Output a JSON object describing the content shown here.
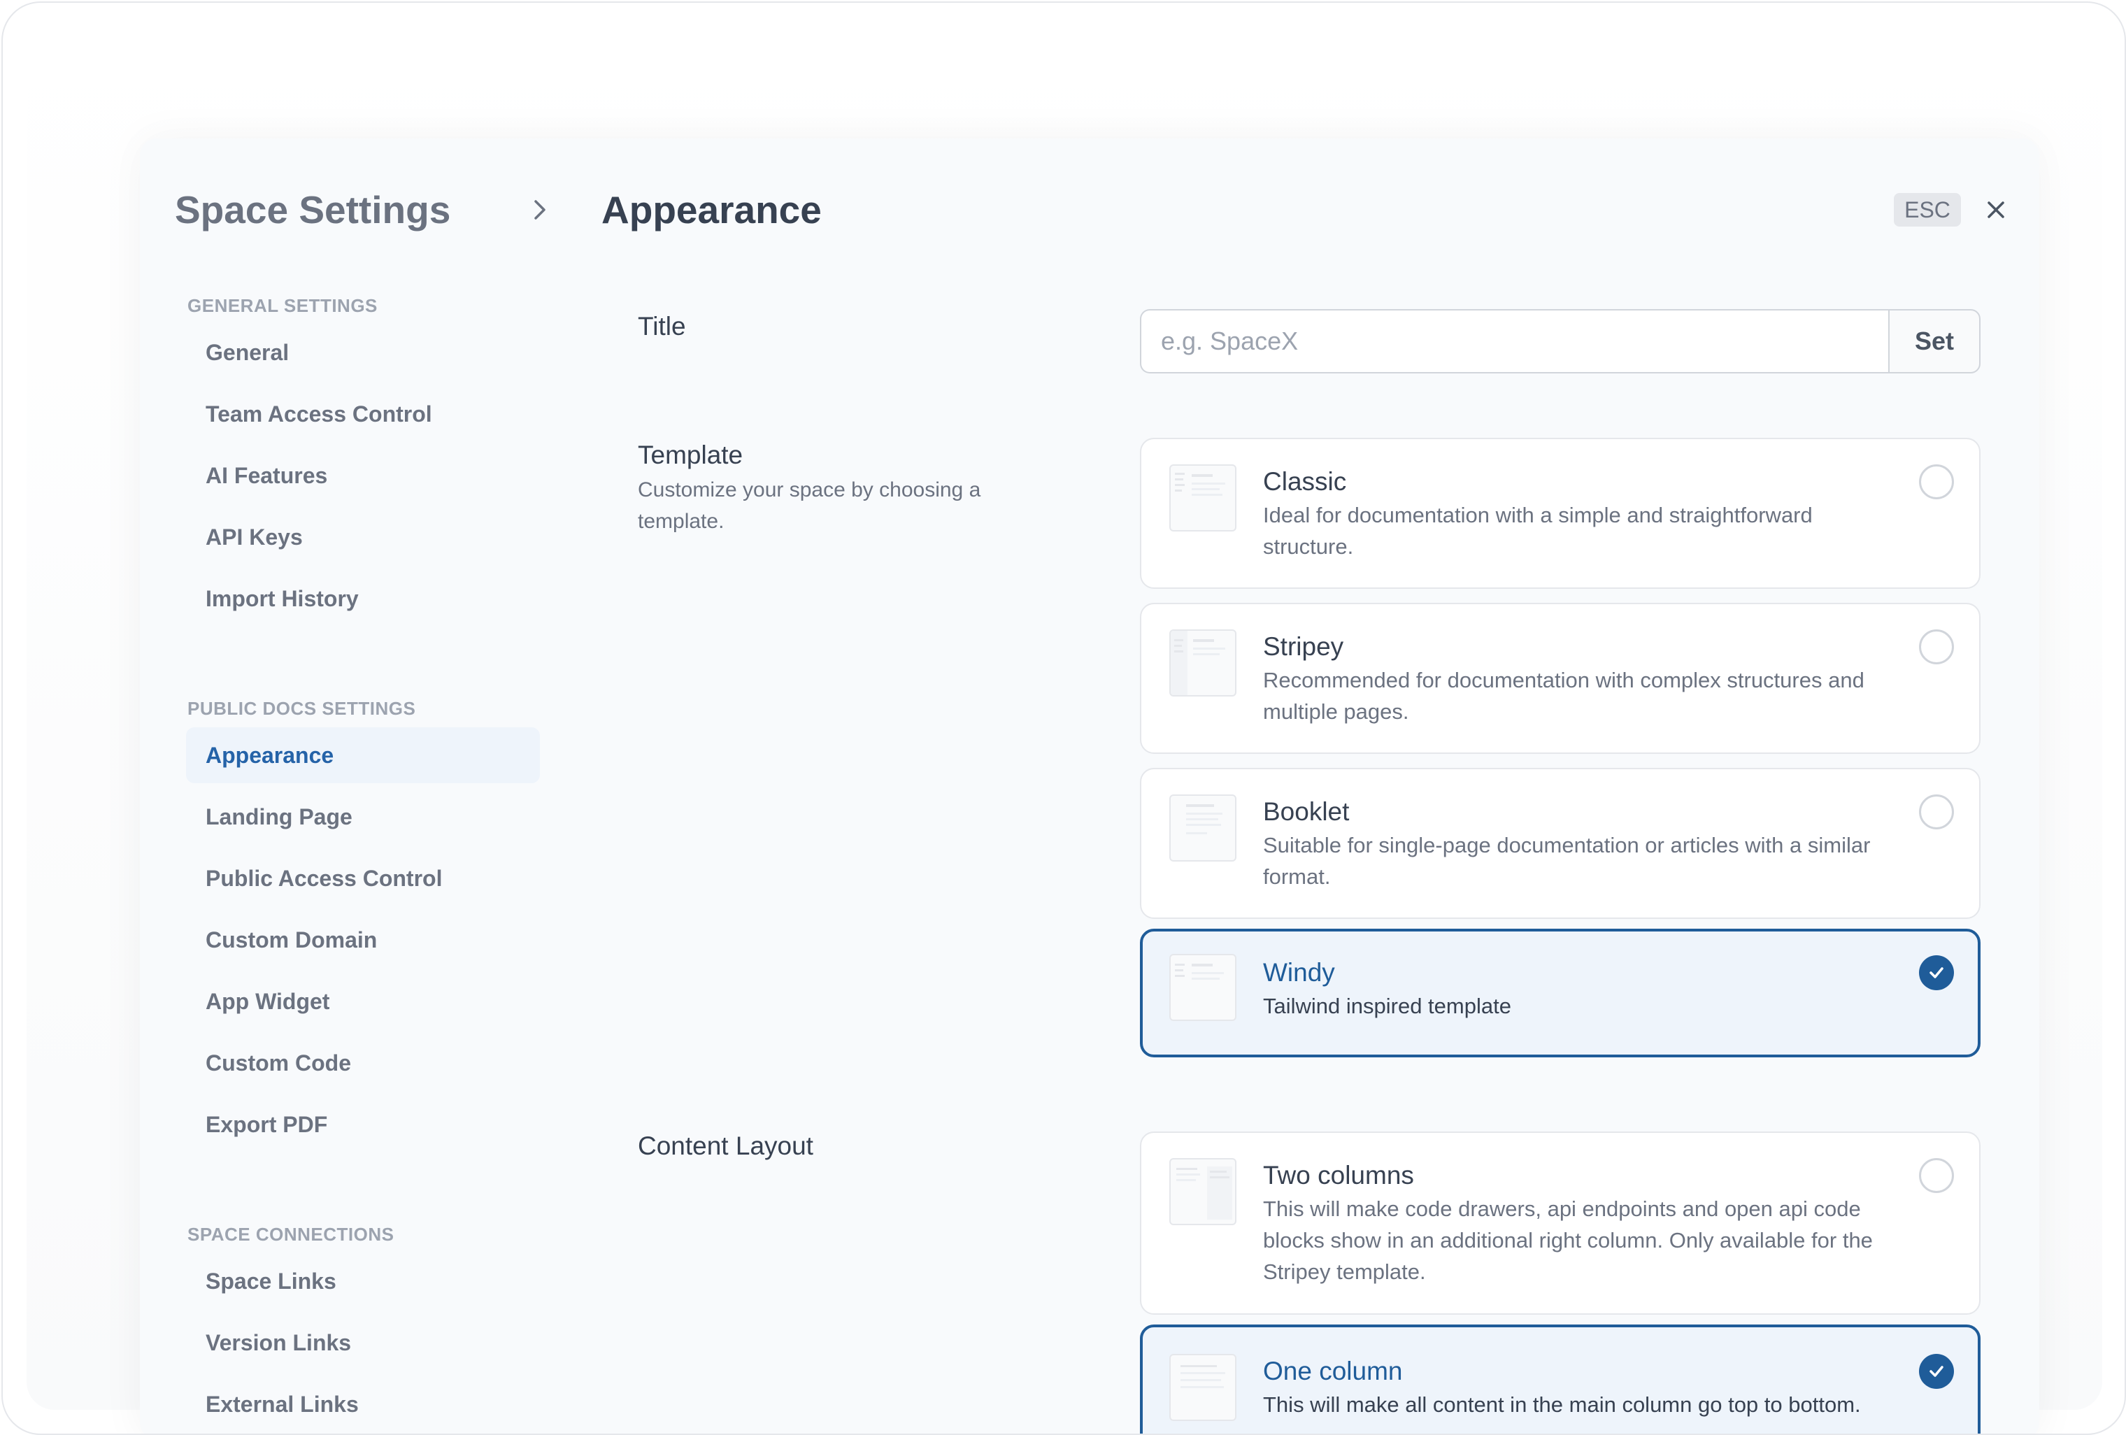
{
  "header": {
    "title": "Space Settings",
    "page": "Appearance",
    "esc_label": "ESC"
  },
  "sidebar": {
    "sections": [
      {
        "heading": "GENERAL SETTINGS",
        "items": [
          "General",
          "Team Access Control",
          "AI Features",
          "API Keys",
          "Import History"
        ]
      },
      {
        "heading": "PUBLIC DOCS SETTINGS",
        "items": [
          "Appearance",
          "Landing Page",
          "Public Access Control",
          "Custom Domain",
          "App Widget",
          "Custom Code",
          "Export PDF"
        ]
      },
      {
        "heading": "SPACE CONNECTIONS",
        "items": [
          "Space Links",
          "Version Links",
          "External Links"
        ]
      }
    ],
    "active_item": "Appearance"
  },
  "title_field": {
    "label": "Title",
    "placeholder": "e.g. SpaceX",
    "value": "",
    "button": "Set"
  },
  "template": {
    "label": "Template",
    "description": "Customize your space by choosing a template.",
    "options": [
      {
        "name": "Classic",
        "description": "Ideal for documentation with a simple and straightforward structure.",
        "selected": false
      },
      {
        "name": "Stripey",
        "description": "Recommended for documentation with complex structures and multiple pages.",
        "selected": false
      },
      {
        "name": "Booklet",
        "description": "Suitable for single-page documentation or articles with a similar format.",
        "selected": false
      },
      {
        "name": "Windy",
        "description": "Tailwind inspired template",
        "selected": true
      }
    ]
  },
  "content_layout": {
    "label": "Content Layout",
    "options": [
      {
        "name": "Two columns",
        "description": "This will make code drawers, api endpoints and open api code blocks show in an additional right column. Only available for the Stripey template.",
        "selected": false
      },
      {
        "name": "One column",
        "description": "This will make all content in the main column go top to bottom.",
        "selected": true
      }
    ]
  },
  "colors": {
    "accent": "#1f5c99",
    "active_bg": "#eef4fb"
  }
}
